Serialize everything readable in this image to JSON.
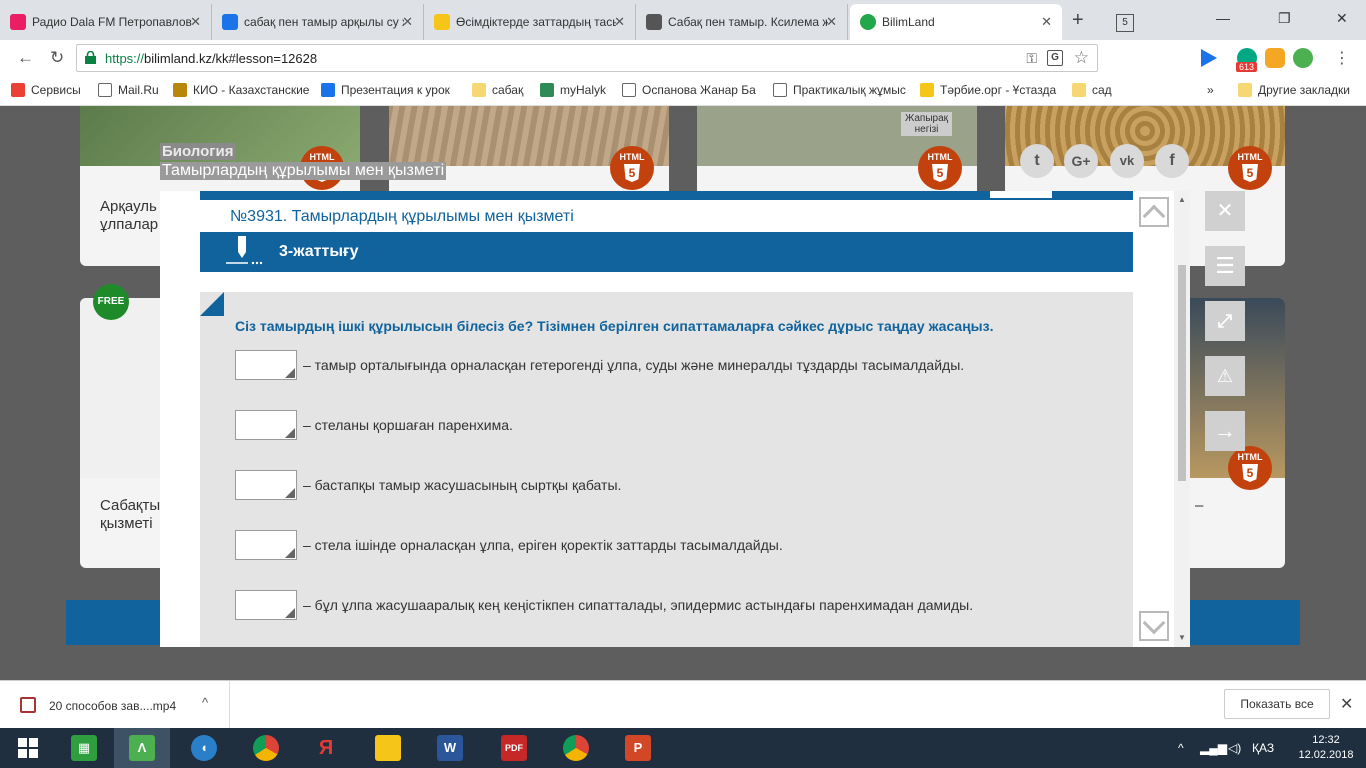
{
  "tabs": [
    {
      "label": "Радио Dala FM Петропавловск",
      "color": "#e91e63"
    },
    {
      "label": "сабақ пен тамыр арқылы су жа",
      "color": "#1a73e8"
    },
    {
      "label": "Өсімдіктерде заттардың тасым",
      "color": "#f5c518"
    },
    {
      "label": "Сабақ пен тамыр. Ксилема жән",
      "color": "#555555"
    },
    {
      "label": "BilimLand",
      "color": "#22a84a"
    }
  ],
  "tab_count": "5",
  "address": {
    "protocol": "https://",
    "rest": "bilimland.kz/kk#lesson=12628"
  },
  "extensions": {
    "badge": "613"
  },
  "bookmarks": [
    {
      "label": "Сервисы",
      "color": "#e94235"
    },
    {
      "label": "Mail.Ru",
      "color": "#666666"
    },
    {
      "label": "КИО - Казахстанские",
      "color": "#b8860b"
    },
    {
      "label": "Презентация к урок",
      "color": "#1a73e8"
    },
    {
      "label": "сабақ",
      "color": "#f7d774"
    },
    {
      "label": "myHalyk",
      "color": "#2e8b57"
    },
    {
      "label": "Оспанова Жанар Ба",
      "color": "#666666"
    },
    {
      "label": "Практикалық жұмыс",
      "color": "#666666"
    },
    {
      "label": "Тәрбие.орг - Ұстазда",
      "color": "#f5c518"
    },
    {
      "label": "сад",
      "color": "#f7d774"
    }
  ],
  "bookmarks_more": "»",
  "bookmarks_other": "Другие закладки",
  "background": {
    "breadcrumb_subject": "Биология",
    "breadcrumb_lesson": "Тамырлардың құрылымы мен қызметі",
    "card1_text": "Арқауль\nұлпалар",
    "card3_text": "Жапырақ\nнегізі",
    "card5_text": "Сабақты\nқызметі",
    "card6_text": "–",
    "free_badge": "FREE",
    "html_badge": "HTML"
  },
  "modal": {
    "lesson_title": "№3931. Тамырлардың құрылымы мен қызметі",
    "exercise_title": "3-жаттығу",
    "question": "Сіз тамырдың ішкі құрылысын білесіз бе? Тізімнен берілген сипаттамаларға сәйкес дұрыс таңдау жасаңыз.",
    "items": [
      "– тамыр орталығында орналасқан гетерогенді ұлпа, суды және минералды тұздарды тасымалдайды.",
      "– стеланы қоршаған паренхима.",
      "– бастапқы тамыр жасушасының сыртқы қабаты.",
      "– стела ішінде орналасқан ұлпа, еріген қоректік заттарды тасымалдайды.",
      "– бұл ұлпа жасушааралық кең кеңістікпен сипатталады, эпидермис астындағы паренхимадан дамиды."
    ]
  },
  "downloads": {
    "file": "20 способов зав....mp4",
    "show_all": "Показать все"
  },
  "taskbar": {
    "lang": "ҚАЗ",
    "time": "12:32",
    "date": "12.02.2018"
  },
  "colors": {
    "brand_blue": "#10639c",
    "overlay": "#5e5e5e"
  }
}
